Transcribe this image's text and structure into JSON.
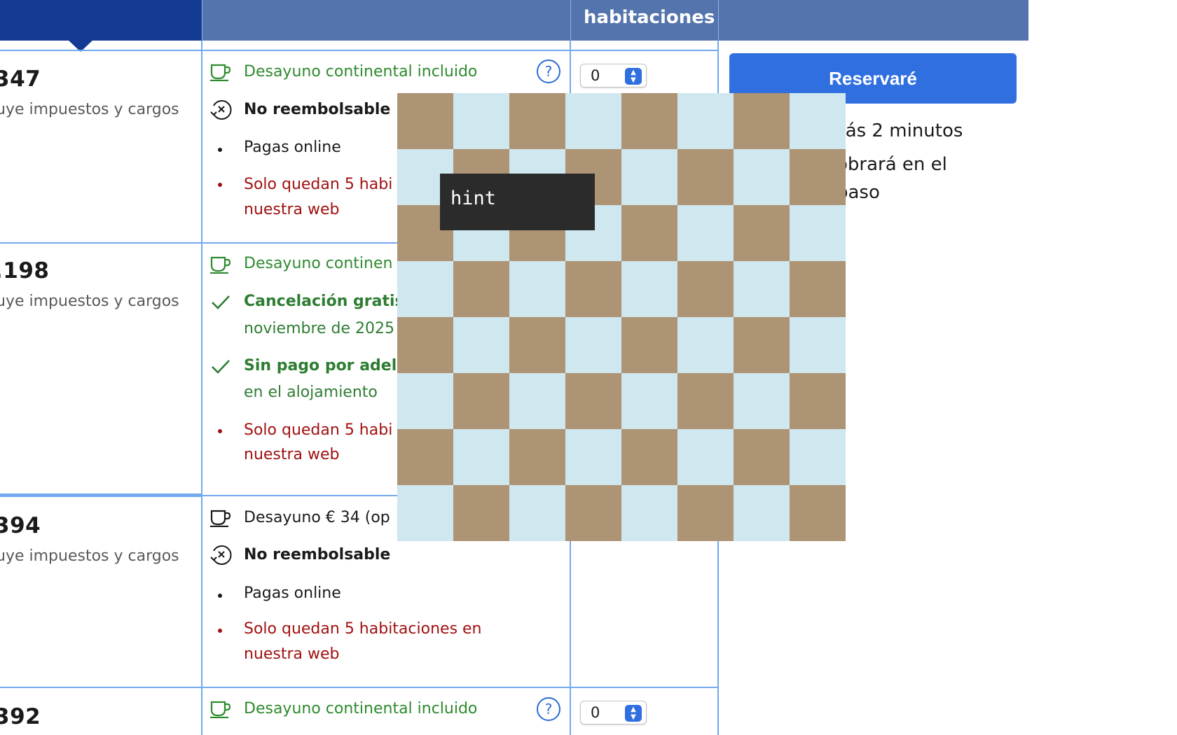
{
  "header": {
    "rooms_heading": "habitaciones"
  },
  "rows": [
    {
      "price": "347",
      "taxes": "uye impuestos y cargos",
      "lines": [
        {
          "text": "Desayuno continental incluido"
        },
        {
          "text": "No reembolsable"
        },
        {
          "text": "Pagas online"
        },
        {
          "text": "Solo quedan 5 habi"
        },
        {
          "text": "nuestra web"
        }
      ],
      "quantity": "0"
    },
    {
      "price": ".198",
      "taxes": "uye impuestos y cargos",
      "lines": [
        {
          "text": "Desayuno continen"
        },
        {
          "text": "Cancelación gratis"
        },
        {
          "text": "noviembre de 2025"
        },
        {
          "text": "Sin pago por adela"
        },
        {
          "text": "en el alojamiento"
        },
        {
          "text": "Solo quedan 5 habi"
        },
        {
          "text": "nuestra web"
        }
      ]
    },
    {
      "price": "394",
      "taxes": "uye impuestos y cargos",
      "lines": [
        {
          "text": "Desayuno € 34 (op"
        },
        {
          "text": "No reembolsable"
        },
        {
          "text": "Pagas online"
        },
        {
          "text": "Solo quedan 5 habitaciones en"
        },
        {
          "text": "nuestra web"
        }
      ]
    },
    {
      "price": "392",
      "lines": [
        {
          "text": "Desayuno continental incluido"
        }
      ],
      "quantity": "0"
    }
  ],
  "booking": {
    "button_label": "Reservaré",
    "info_line1": "rás 2 minutos",
    "info_line2": "obrará en el",
    "info_line3": "paso"
  },
  "overlay": {
    "tooltip_text": "hint"
  },
  "colors": {
    "header_dark": "#143a94",
    "header_light": "#5474ad",
    "accent_blue": "#2f6fe0",
    "green": "#2e8a2e",
    "red": "#a01111",
    "checker_light": "#cfe7ee",
    "checker_dark": "#ad9474"
  },
  "icons": [
    "coffee-cup-icon",
    "no-refund-icon",
    "checkmark-icon",
    "help-icon",
    "stepper-arrows-icon"
  ]
}
